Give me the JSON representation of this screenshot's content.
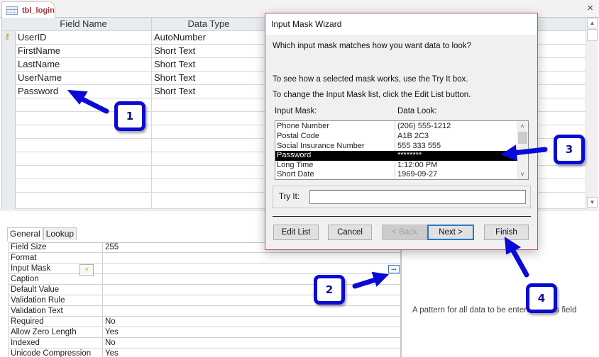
{
  "document": {
    "tab_label": "tbl_login",
    "close_glyph": "×"
  },
  "grid": {
    "headers": [
      "Field Name",
      "Data Type"
    ],
    "rows": [
      {
        "field": "UserID",
        "type": "AutoNumber",
        "primary_key": true
      },
      {
        "field": "FirstName",
        "type": "Short Text"
      },
      {
        "field": "LastName",
        "type": "Short Text"
      },
      {
        "field": "UserName",
        "type": "Short Text"
      },
      {
        "field": "Password",
        "type": "Short Text"
      }
    ],
    "key_glyph": "⚷",
    "scroll_up": "▲",
    "scroll_down": "▼"
  },
  "properties": {
    "tabs": [
      "General",
      "Lookup"
    ],
    "active_tab": "General",
    "rows": [
      {
        "label": "Field Size",
        "value": "255"
      },
      {
        "label": "Format",
        "value": ""
      },
      {
        "label": "Input Mask",
        "value": ""
      },
      {
        "label": "Caption",
        "value": ""
      },
      {
        "label": "Default Value",
        "value": ""
      },
      {
        "label": "Validation Rule",
        "value": ""
      },
      {
        "label": "Validation Text",
        "value": ""
      },
      {
        "label": "Required",
        "value": "No"
      },
      {
        "label": "Allow Zero Length",
        "value": "Yes"
      },
      {
        "label": "Indexed",
        "value": "No"
      },
      {
        "label": "Unicode Compression",
        "value": "Yes"
      }
    ],
    "builder_glyph": "⚡",
    "ellipsis_label": "...",
    "help_text": "A pattern for all data to be entered in this field"
  },
  "dialog": {
    "title": "Input Mask Wizard",
    "question": "Which input mask matches how you want data to look?",
    "hint1": "To see how a selected mask works, use the Try It box.",
    "hint2": "To change the Input Mask list, click the Edit List button.",
    "col_mask": "Input Mask:",
    "col_look": "Data Look:",
    "masks": [
      {
        "name": "Phone Number",
        "look": "(206) 555-1212"
      },
      {
        "name": "Postal Code",
        "look": "A1B 2C3"
      },
      {
        "name": "Social Insurance Number",
        "look": "555 333 555"
      },
      {
        "name": "Password",
        "look": "********",
        "selected": true
      },
      {
        "name": "Long Time",
        "look": "1:12:00 PM"
      },
      {
        "name": "Short Date",
        "look": "1969-09-27"
      }
    ],
    "scroll_up": "˄",
    "scroll_down": "˅",
    "tryit_label": "Try It:",
    "tryit_value": "",
    "buttons": {
      "edit_list": "Edit List",
      "cancel": "Cancel",
      "back": "< Back",
      "next": "Next >",
      "finish": "Finish"
    }
  },
  "annotations": {
    "colors": {
      "arrow": "#0a0ad6",
      "text": "#10108a"
    },
    "callouts": [
      "1",
      "2",
      "3",
      "4"
    ]
  }
}
